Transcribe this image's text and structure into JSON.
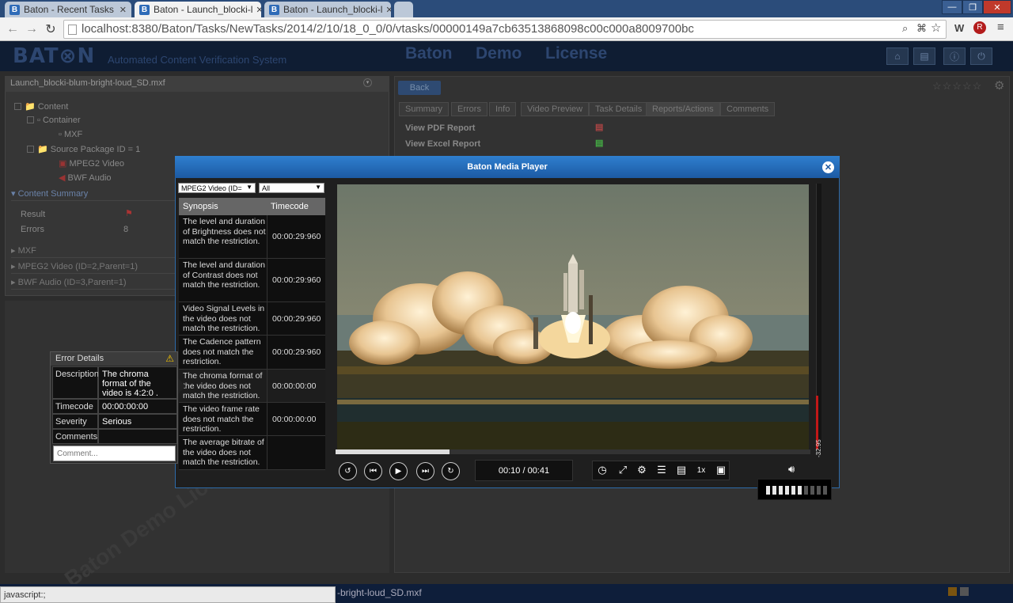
{
  "browser": {
    "tabs": [
      {
        "label": "Baton - Recent Tasks",
        "icon": "baton-favicon"
      },
      {
        "label": "Baton - Launch_blocki-l",
        "icon": "baton-favicon"
      },
      {
        "label": "Baton - Launch_blocki-l",
        "icon": "baton-favicon"
      }
    ],
    "active_tab": 1,
    "address": "localhost:8380/Baton/Tasks/NewTasks/2014/2/10/18_0_0/0/vtasks/00000149a7cb63513868098c00c000a8009700bc",
    "extensions": [
      "W",
      "R"
    ]
  },
  "app": {
    "logo": "BAT⊗N",
    "tagline": "Automated Content Verification System",
    "nav": [
      "Baton",
      "Demo",
      "License"
    ],
    "header_icons": [
      "home-icon",
      "tasks-icon",
      "info-icon",
      "power-icon"
    ]
  },
  "left_panel": {
    "file": "Launch_blocki-blum-bright-loud_SD.mxf",
    "tree": [
      "Content",
      "Container",
      "MXF",
      "Source Package ID = 1",
      "MPEG2 Video",
      "BWF Audio"
    ],
    "content_summary": {
      "title": "Content Summary",
      "rows": [
        {
          "label": "Result",
          "value": ""
        },
        {
          "label": "Errors",
          "value": "8"
        }
      ]
    },
    "sections": [
      "MXF",
      "MPEG2 Video (ID=2,Parent=1)",
      "BWF Audio (ID=3,Parent=1)"
    ]
  },
  "right_panel": {
    "back": "Back",
    "tabs": [
      "Summary",
      "Errors",
      "Info",
      "Video Preview",
      "Task Details",
      "Reports/Actions",
      "Comments"
    ],
    "reports": [
      "View PDF Report",
      "View Excel Report"
    ]
  },
  "player": {
    "title": "Baton Media Player",
    "stream_select": "MPEG2 Video (ID=",
    "filter_select": "All",
    "columns": [
      "Synopsis",
      "Timecode"
    ],
    "rows": [
      {
        "synopsis": "The level and duration of Brightness does not match the restriction.",
        "timecode": "00:00:29:960"
      },
      {
        "synopsis": "The level and duration of Contrast does not match the restriction.",
        "timecode": "00:00:29:960"
      },
      {
        "synopsis": "Video Signal Levels in the video does not match the restriction.",
        "timecode": "00:00:29:960"
      },
      {
        "synopsis": "The Cadence pattern does not match the restriction.",
        "timecode": "00:00:29:960"
      },
      {
        "synopsis": "The chroma format of the video does not match the restriction.",
        "timecode": "00:00:00:00"
      },
      {
        "synopsis": "The video frame rate does not match the restriction.",
        "timecode": "00:00:00:00"
      },
      {
        "synopsis": "The average bitrate of the video does not match the restriction.",
        "timecode": ""
      }
    ],
    "time": "00:10 / 00:41",
    "progress_fraction": 0.24,
    "speed": "1x",
    "meter_label": "-32.95",
    "volume_level": 0.6
  },
  "error_details": {
    "title": "Error Details",
    "description_label": "Description",
    "description": "The chroma format of the video is 4:2:0 .",
    "timecode_label": "Timecode",
    "timecode": "00:00:00:00",
    "severity_label": "Severity",
    "severity": "Serious",
    "comments_label": "Comments",
    "comment_placeholder": "Comment..."
  },
  "status": {
    "left": "javascript:;",
    "file": "-bright-loud_SD.mxf"
  },
  "watermark": "Baton Demo License"
}
